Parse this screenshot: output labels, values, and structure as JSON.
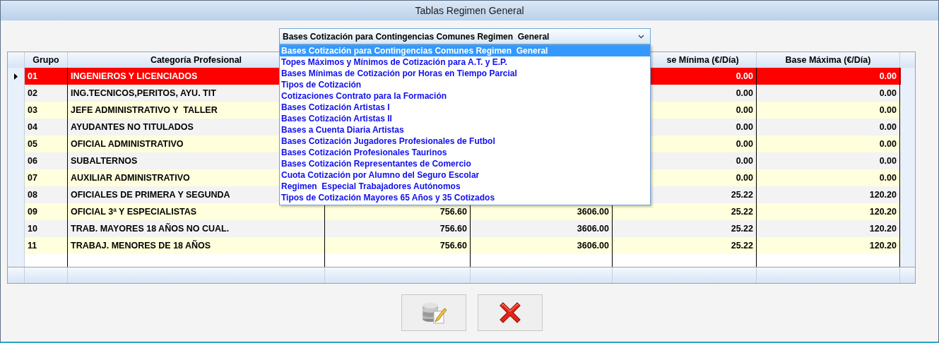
{
  "window": {
    "title": "Tablas Regimen General"
  },
  "selector": {
    "value": "Bases Cotización para Contingencias Comunes Regimen  General",
    "expanded": true,
    "options": [
      {
        "label": "Bases Cotización para Contingencias Comunes Regimen  General",
        "selected": true
      },
      {
        "label": "Topes Máximos y Mínimos de Cotización para A.T. y E.P.",
        "selected": false
      },
      {
        "label": "Bases Mínimas de Cotización por Horas en Tiempo Parcial",
        "selected": false
      },
      {
        "label": "Tipos de Cotización",
        "selected": false
      },
      {
        "label": "Cotizaciones Contrato para la Formación",
        "selected": false
      },
      {
        "label": "Bases Cotización Artistas I",
        "selected": false
      },
      {
        "label": "Bases Cotización Artistas II",
        "selected": false
      },
      {
        "label": "Bases a Cuenta Diaria Artistas",
        "selected": false
      },
      {
        "label": "Bases Cotización Jugadores Profesionales de Futbol",
        "selected": false
      },
      {
        "label": "Bases Cotización Profesionales Taurinos",
        "selected": false
      },
      {
        "label": "Bases Cotización Representantes de Comercio",
        "selected": false
      },
      {
        "label": "Cuota Cotización por Alumno del Seguro Escolar",
        "selected": false
      },
      {
        "label": "Regimen  Especial Trabajadores Autónomos",
        "selected": false
      },
      {
        "label": "Tipos de Cotización Mayores 65 Años y 35 Cotizados",
        "selected": false
      }
    ]
  },
  "table": {
    "columns": {
      "grupo": "Grupo",
      "categoria": "Categoría Profesional",
      "base_minima": "se Mínima (€/Día)",
      "base_maxima": "Base Máxima (€/Día)"
    },
    "rows": [
      {
        "grupo": "01",
        "categoria": "INGENIEROS Y LICENCIADOS",
        "base_minima": "0.00",
        "base_maxima": "0.00",
        "selected": true
      },
      {
        "grupo": "02",
        "categoria": "ING.TECNICOS,PERITOS, AYU. TIT",
        "base_minima": "0.00",
        "base_maxima": "0.00",
        "selected": false
      },
      {
        "grupo": "03",
        "categoria": "JEFE ADMINISTRATIVO Y  TALLER",
        "base_minima": "0.00",
        "base_maxima": "0.00",
        "selected": false
      },
      {
        "grupo": "04",
        "categoria": "AYUDANTES NO TITULADOS",
        "base_minima": "0.00",
        "base_maxima": "0.00",
        "selected": false
      },
      {
        "grupo": "05",
        "categoria": "OFICIAL ADMINISTRATIVO",
        "base_minima": "0.00",
        "base_maxima": "0.00",
        "selected": false
      },
      {
        "grupo": "06",
        "categoria": "SUBALTERNOS",
        "base_minima": "0.00",
        "base_maxima": "0.00",
        "selected": false
      },
      {
        "grupo": "07",
        "categoria": "AUXILIAR ADMINISTRATIVO",
        "base_minima": "0.00",
        "base_maxima": "0.00",
        "selected": false
      },
      {
        "grupo": "08",
        "categoria": "OFICIALES DE PRIMERA Y SEGUNDA",
        "base_minima": "25.22",
        "base_maxima": "120.20",
        "selected": false
      },
      {
        "grupo": "09",
        "categoria": "OFICIAL 3ª Y ESPECIALISTAS",
        "column_3": "756.60",
        "column_4": "3606.00",
        "base_minima": "25.22",
        "base_maxima": "120.20",
        "selected": false
      },
      {
        "grupo": "10",
        "categoria": "TRAB. MAYORES 18 AÑOS NO CUAL.",
        "column_3": "756.60",
        "column_4": "3606.00",
        "base_minima": "25.22",
        "base_maxima": "120.20",
        "selected": false
      },
      {
        "grupo": "11",
        "categoria": "TRABAJ. MENORES DE 18 AÑOS",
        "column_3": "756.60",
        "column_4": "3606.00",
        "base_minima": "25.22",
        "base_maxima": "120.20",
        "selected": false
      }
    ]
  },
  "buttons": [
    {
      "kind": "edit"
    },
    {
      "kind": "cancel"
    }
  ]
}
